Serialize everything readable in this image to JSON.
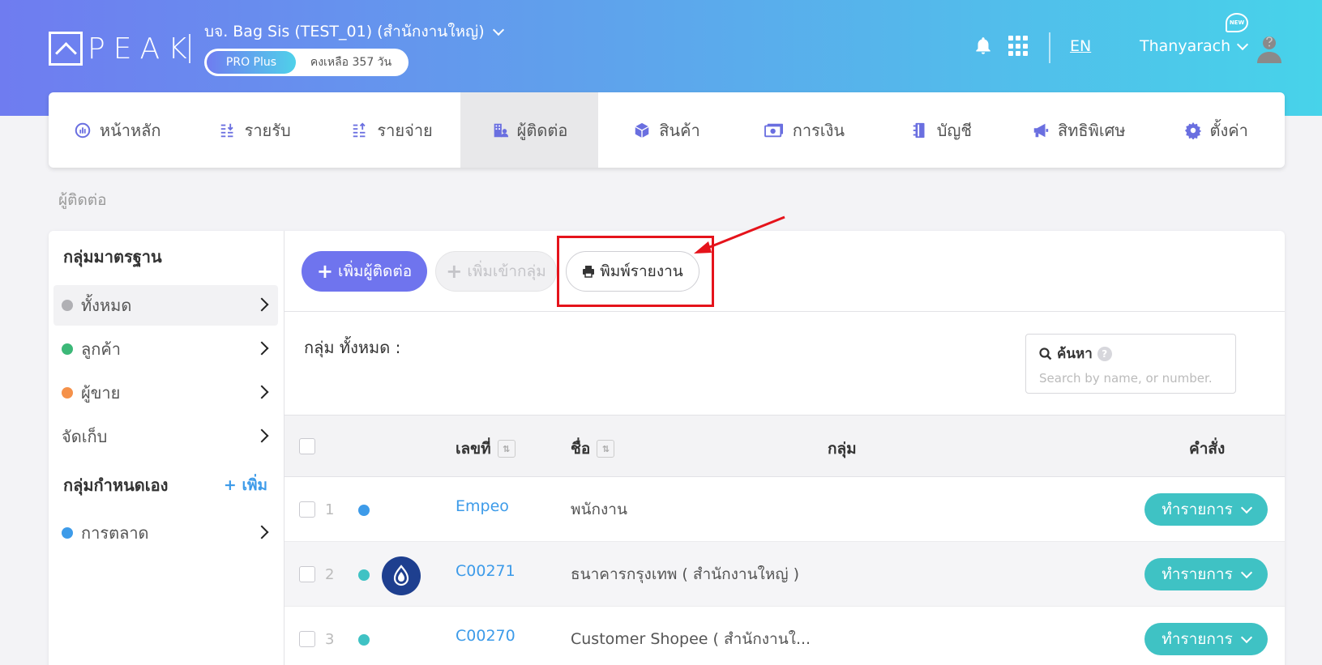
{
  "header": {
    "logo": "PEAK",
    "company": "บจ. Bag Sis (TEST_01) (สำนักงานใหญ่)",
    "plan": "PRO Plus",
    "remaining": "คงเหลือ 357 วัน",
    "lang": "EN",
    "user": "Thanyarach",
    "new_badge": "NEW"
  },
  "nav": {
    "items": [
      {
        "label": "หน้าหลัก",
        "icon": "dashboard-icon"
      },
      {
        "label": "รายรับ",
        "icon": "income-icon"
      },
      {
        "label": "รายจ่าย",
        "icon": "expense-icon"
      },
      {
        "label": "ผู้ติดต่อ",
        "icon": "contacts-icon"
      },
      {
        "label": "สินค้า",
        "icon": "box-icon"
      },
      {
        "label": "การเงิน",
        "icon": "money-icon"
      },
      {
        "label": "บัญชี",
        "icon": "book-icon"
      },
      {
        "label": "สิทธิพิเศษ",
        "icon": "megaphone-icon"
      },
      {
        "label": "ตั้งค่า",
        "icon": "gear-icon"
      }
    ],
    "active_index": 3
  },
  "breadcrumb": "ผู้ติดต่อ",
  "sidebar": {
    "standard_title": "กลุ่มมาตรฐาน",
    "standard_items": [
      {
        "label": "ทั้งหมด",
        "color": "#b0b0b4"
      },
      {
        "label": "ลูกค้า",
        "color": "#3cb878"
      },
      {
        "label": "ผู้ขาย",
        "color": "#f5914a"
      },
      {
        "label": "จัดเก็บ",
        "color": ""
      }
    ],
    "custom_title": "กลุ่มกำหนดเอง",
    "custom_add": "+ เพิ่ม",
    "custom_items": [
      {
        "label": "การตลาด",
        "color": "#3d9be9"
      }
    ]
  },
  "toolbar": {
    "add_contact": "เพิ่มผู้ติดต่อ",
    "add_to_group": "เพิ่มเข้ากลุ่ม",
    "print_report": "พิมพ์รายงาน"
  },
  "group_label": "กลุ่ม ทั้งหมด :",
  "search": {
    "title": "ค้นหา",
    "placeholder": "Search by name, or number."
  },
  "table": {
    "headers": {
      "number": "เลขที่",
      "name": "ชื่อ",
      "group": "กลุ่ม",
      "action": "คำสั่ง"
    },
    "rows": [
      {
        "index": "1",
        "code": "Empeo",
        "name": "พนักงาน",
        "dot": "#3d9be9",
        "action": "ทำรายการ"
      },
      {
        "index": "2",
        "code": "C00271",
        "name": "ธนาคารกรุงเทพ ( สำนักงานใหญ่ )",
        "dot": "#3fc2c4",
        "action": "ทำรายการ"
      },
      {
        "index": "3",
        "code": "C00270",
        "name": "Customer Shopee ( สำนักงานใ...",
        "dot": "#3fc2c4",
        "action": "ทำรายการ"
      }
    ]
  },
  "colors": {
    "primary": "#6f74ee",
    "action": "#3fc2c4",
    "link": "#3d9be9",
    "highlight": "#e5131b"
  }
}
